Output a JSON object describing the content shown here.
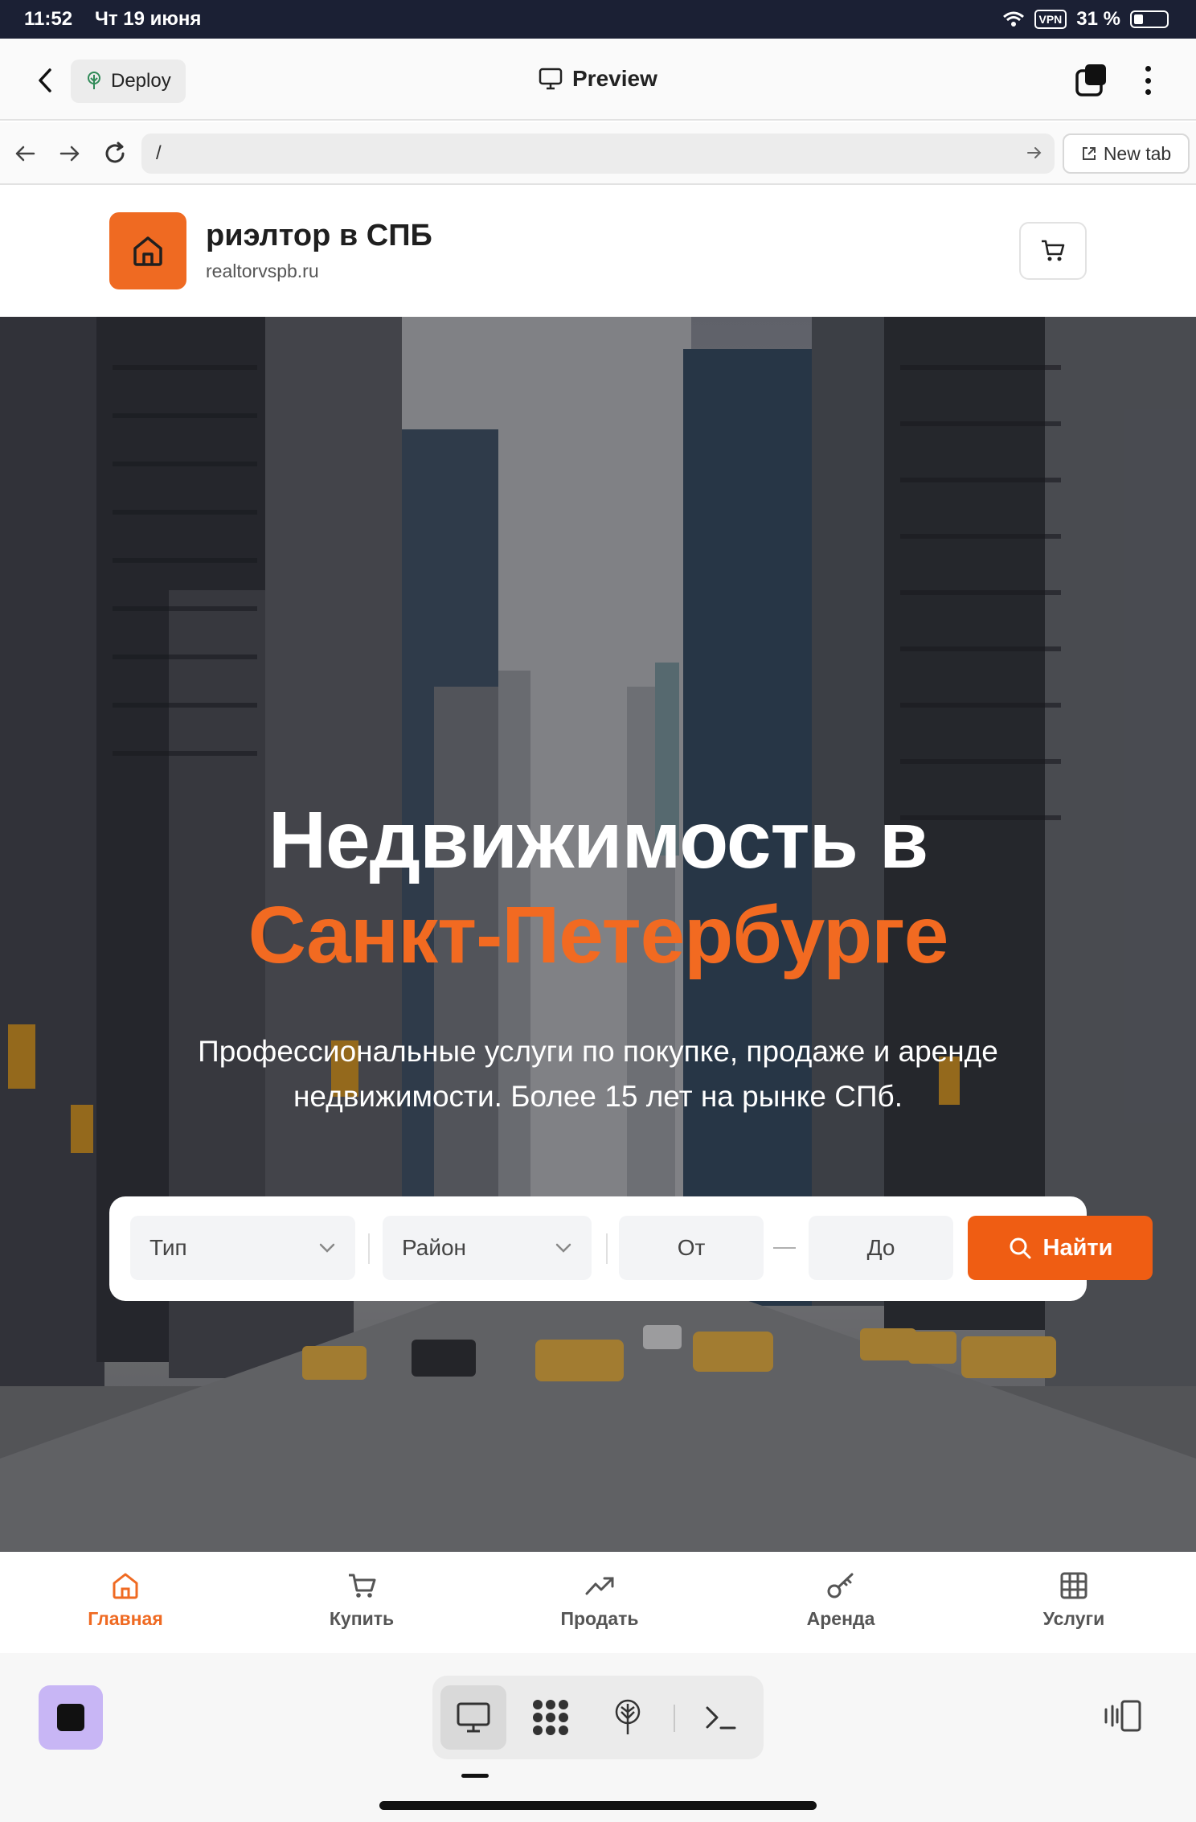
{
  "status_bar": {
    "time": "11:52",
    "date": "Чт 19 июня",
    "vpn": "VPN",
    "battery": "31 %"
  },
  "app_toolbar": {
    "deploy_label": "Deploy",
    "preview_label": "Preview"
  },
  "address_bar": {
    "url": "/",
    "new_tab_label": "New tab"
  },
  "site": {
    "brand_name": "риэлтор в СПБ",
    "brand_domain": "realtorvspb.ru",
    "accent_color": "#EF6A22"
  },
  "hero": {
    "title_line1": "Недвижимость в",
    "title_line2": "Санкт-Петербурге",
    "subtitle": "Профессиональные услуги по покупке, продаже и аренде недвижимости. Более 15 лет на рынке СПб."
  },
  "search": {
    "type_label": "Тип",
    "district_label": "Район",
    "price_from": "От",
    "price_separator": "—",
    "price_to": "До",
    "find_label": "Найти"
  },
  "site_nav": {
    "items": [
      {
        "label": "Главная",
        "icon": "home-icon",
        "active": true
      },
      {
        "label": "Купить",
        "icon": "cart-icon",
        "active": false
      },
      {
        "label": "Продать",
        "icon": "trend-up-icon",
        "active": false
      },
      {
        "label": "Аренда",
        "icon": "key-icon",
        "active": false
      },
      {
        "label": "Услуги",
        "icon": "grid-icon",
        "active": false
      }
    ]
  },
  "dev_dock": {
    "segments": [
      {
        "icon": "monitor-icon",
        "active": true
      },
      {
        "icon": "apps-icon",
        "active": false
      },
      {
        "icon": "deploy-tree-icon",
        "active": false
      },
      {
        "icon": "terminal-icon",
        "active": false
      }
    ]
  }
}
